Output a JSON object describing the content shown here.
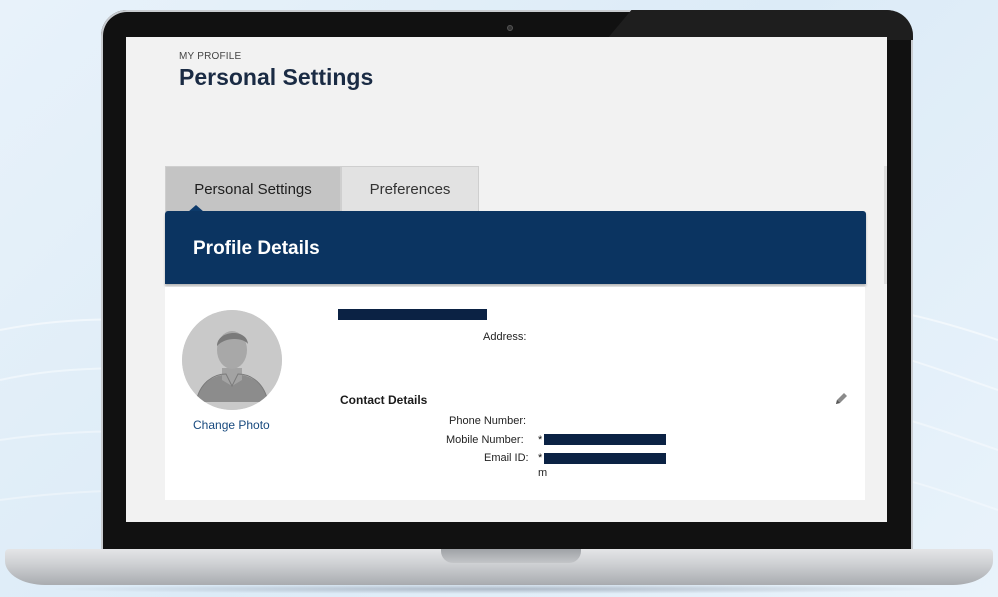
{
  "header": {
    "eyebrow": "MY PROFILE",
    "title": "Personal Settings"
  },
  "tabs": [
    {
      "label": "Personal Settings",
      "active": true
    },
    {
      "label": "Preferences",
      "active": false
    }
  ],
  "profile": {
    "section_title": "Profile Details",
    "change_photo_label": "Change Photo",
    "address_label": "Address:",
    "contact_title": "Contact Details",
    "phone_label": "Phone Number:",
    "mobile_label": "Mobile Number:",
    "mobile_prefix": "*",
    "email_label": "Email ID:",
    "email_prefix": "*",
    "email_tail": "m"
  },
  "colors": {
    "header_bg": "#0b3461",
    "link": "#17497e",
    "redaction": "#0b2244"
  },
  "icons": {
    "edit": "pencil-icon",
    "avatar": "user-silhouette-icon"
  }
}
